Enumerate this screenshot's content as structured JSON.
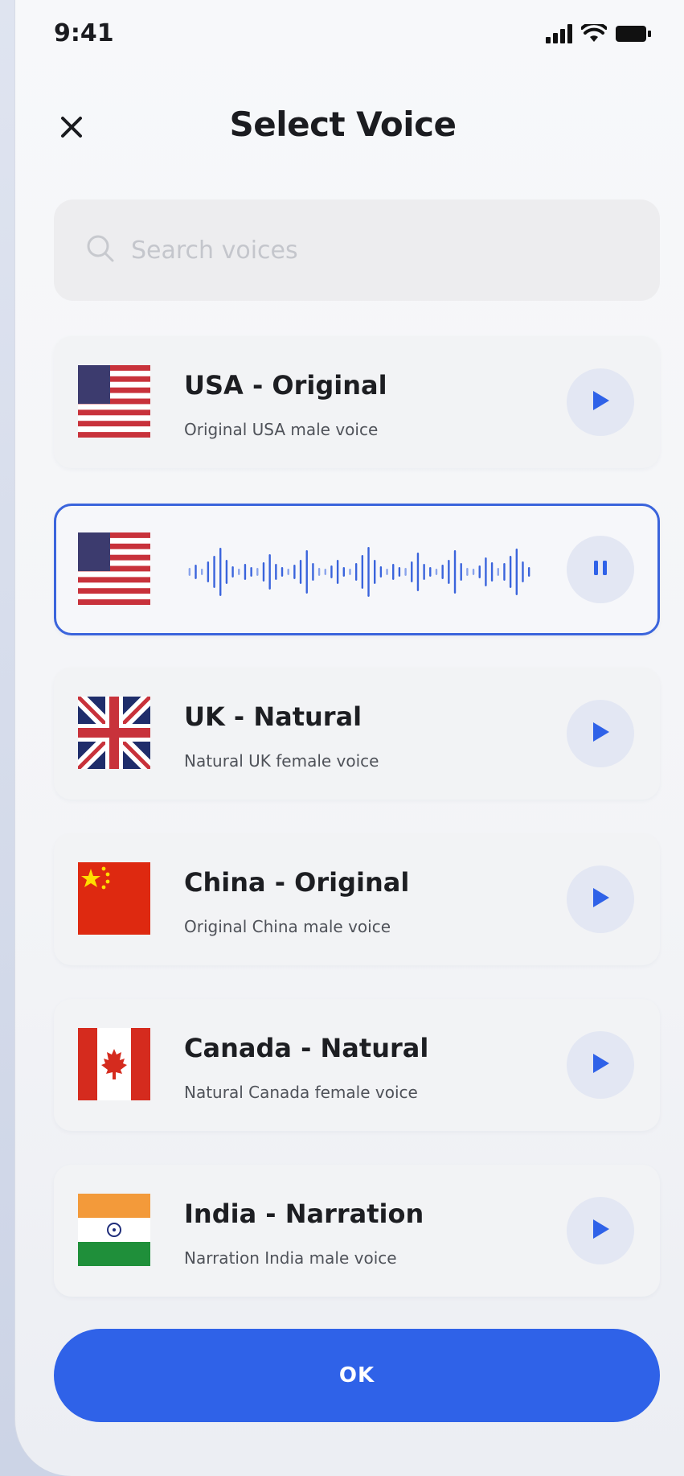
{
  "status_bar": {
    "time": "9:41"
  },
  "header": {
    "title": "Select Voice"
  },
  "search": {
    "placeholder": "Search voices",
    "value": ""
  },
  "voices": [
    {
      "flag": "usa-flag",
      "name": "USA - Original",
      "description": "Original USA male voice",
      "state": "play"
    },
    {
      "flag": "usa-flag",
      "name": "",
      "description": "",
      "state": "playing"
    },
    {
      "flag": "uk-flag",
      "name": "UK - Natural",
      "description": "Natural UK female voice",
      "state": "play"
    },
    {
      "flag": "china-flag",
      "name": "China - Original",
      "description": "Original China male voice",
      "state": "play"
    },
    {
      "flag": "canada-flag",
      "name": "Canada - Natural",
      "description": "Natural Canada female voice",
      "state": "play"
    },
    {
      "flag": "india-flag",
      "name": "India - Narration",
      "description": "Narration India male voice",
      "state": "play"
    }
  ],
  "footer": {
    "ok_label": "OK"
  },
  "colors": {
    "accent": "#2f62e8",
    "active_border": "#3a64dc",
    "play_button_bg": "#e3e7f3",
    "card_bg": "#f2f3f5"
  }
}
